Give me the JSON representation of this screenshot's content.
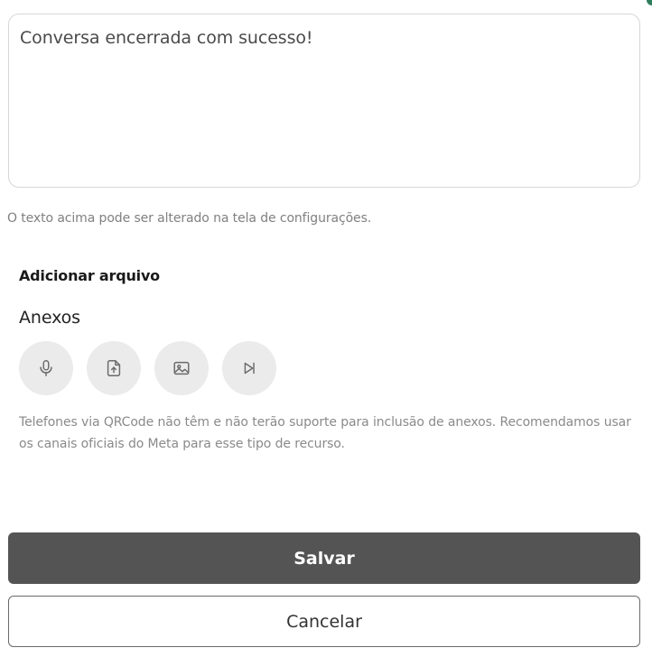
{
  "message": {
    "text": "Conversa encerrada com sucesso!"
  },
  "helper_text": "O texto acima pode ser alterado na tela de configurações.",
  "attachments": {
    "section_title": "Adicionar arquivo",
    "label": "Anexos",
    "buttons": [
      {
        "icon": "microphone-icon"
      },
      {
        "icon": "file-upload-icon"
      },
      {
        "icon": "image-icon"
      },
      {
        "icon": "video-icon"
      }
    ],
    "notice": "Telefones via QRCode não têm e não terão suporte para inclusão de anexos. Recomendamos usar os canais oficiais do Meta para esse tipo de recurso."
  },
  "actions": {
    "save_label": "Salvar",
    "cancel_label": "Cancelar"
  },
  "colors": {
    "primary_button": "#545454",
    "icon_bg": "#ebebeb",
    "accent": "#2e7d5b"
  }
}
